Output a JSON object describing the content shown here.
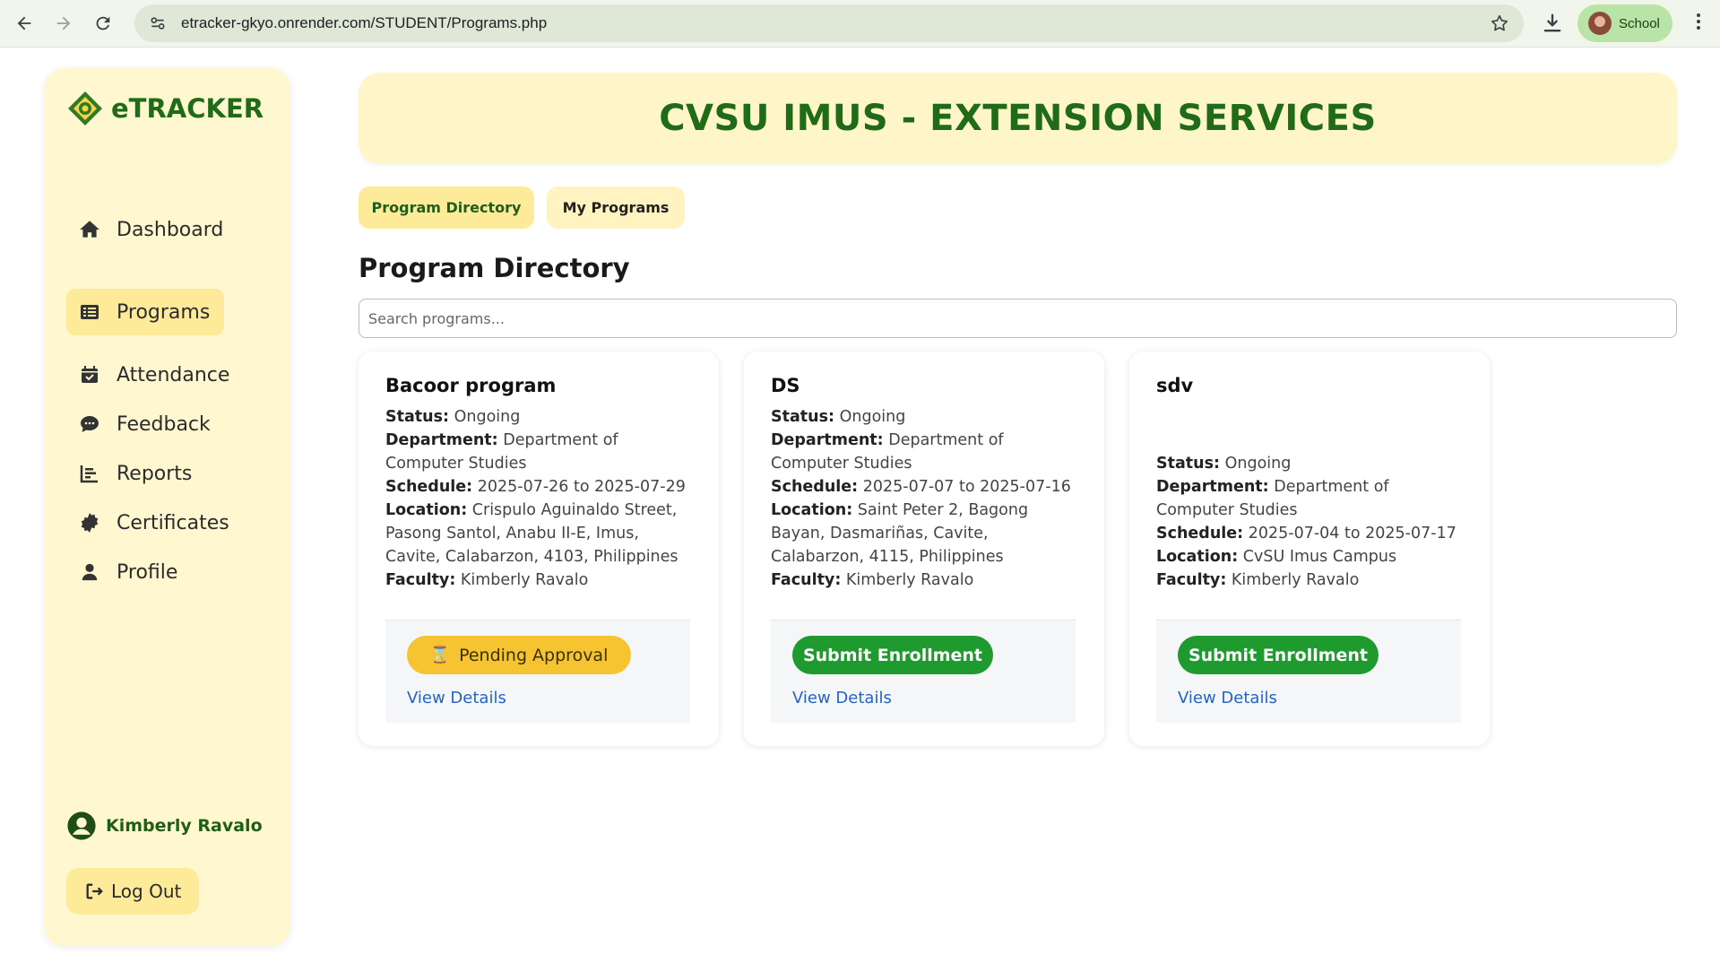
{
  "browser": {
    "url": "etracker-gkyo.onrender.com/STUDENT/Programs.php",
    "profile_label": "School"
  },
  "sidebar": {
    "brand": "eTRACKER",
    "items": [
      {
        "label": "Dashboard",
        "icon": "home-icon"
      },
      {
        "label": "Programs",
        "icon": "list-icon",
        "active": true
      },
      {
        "label": "Attendance",
        "icon": "calendar-check-icon"
      },
      {
        "label": "Feedback",
        "icon": "comment-icon"
      },
      {
        "label": "Reports",
        "icon": "bar-chart-icon"
      },
      {
        "label": "Certificates",
        "icon": "certificate-icon"
      },
      {
        "label": "Profile",
        "icon": "user-icon"
      }
    ],
    "user_name": "Kimberly Ravalo",
    "logout_label": "Log Out"
  },
  "header": {
    "title": "CVSU IMUS - EXTENSION SERVICES"
  },
  "tabs": [
    {
      "label": "Program Directory",
      "active": true
    },
    {
      "label": "My Programs",
      "active": false
    }
  ],
  "main": {
    "section_title": "Program Directory",
    "search_placeholder": "Search programs..."
  },
  "labels": {
    "status": "Status:",
    "department": "Department:",
    "schedule": "Schedule:",
    "location": "Location:",
    "faculty": "Faculty:"
  },
  "programs": [
    {
      "title": "Bacoor program",
      "status": "Ongoing",
      "department": "Department of Computer Studies",
      "schedule": "2025-07-26 to 2025-07-29",
      "location": "Crispulo Aguinaldo Street, Pasong Santol, Anabu II-E, Imus, Cavite, Calabarzon, 4103, Philippines",
      "faculty": "Kimberly Ravalo",
      "action_label": "Pending Approval",
      "action_type": "pending",
      "link_label": "View Details"
    },
    {
      "title": "DS",
      "status": "Ongoing",
      "department": "Department of Computer Studies",
      "schedule": "2025-07-07 to 2025-07-16",
      "location": "Saint Peter 2, Bagong Bayan, Dasmariñas, Cavite, Calabarzon, 4115, Philippines",
      "faculty": "Kimberly Ravalo",
      "action_label": "Submit Enrollment",
      "action_type": "submit",
      "link_label": "View Details"
    },
    {
      "title": "sdv",
      "status": "Ongoing",
      "department": "Department of Computer Studies",
      "schedule": "2025-07-04 to 2025-07-17",
      "location": "CvSU Imus Campus",
      "faculty": "Kimberly Ravalo",
      "action_label": "Submit Enrollment",
      "action_type": "submit",
      "link_label": "View Details"
    }
  ],
  "colors": {
    "brand_green": "#1f6b18",
    "sidebar_bg": "#fff7cf",
    "active_yellow": "#fdeb9a",
    "pending_yellow": "#f6c431",
    "submit_green": "#1e9a2f",
    "link_blue": "#2563c6"
  }
}
